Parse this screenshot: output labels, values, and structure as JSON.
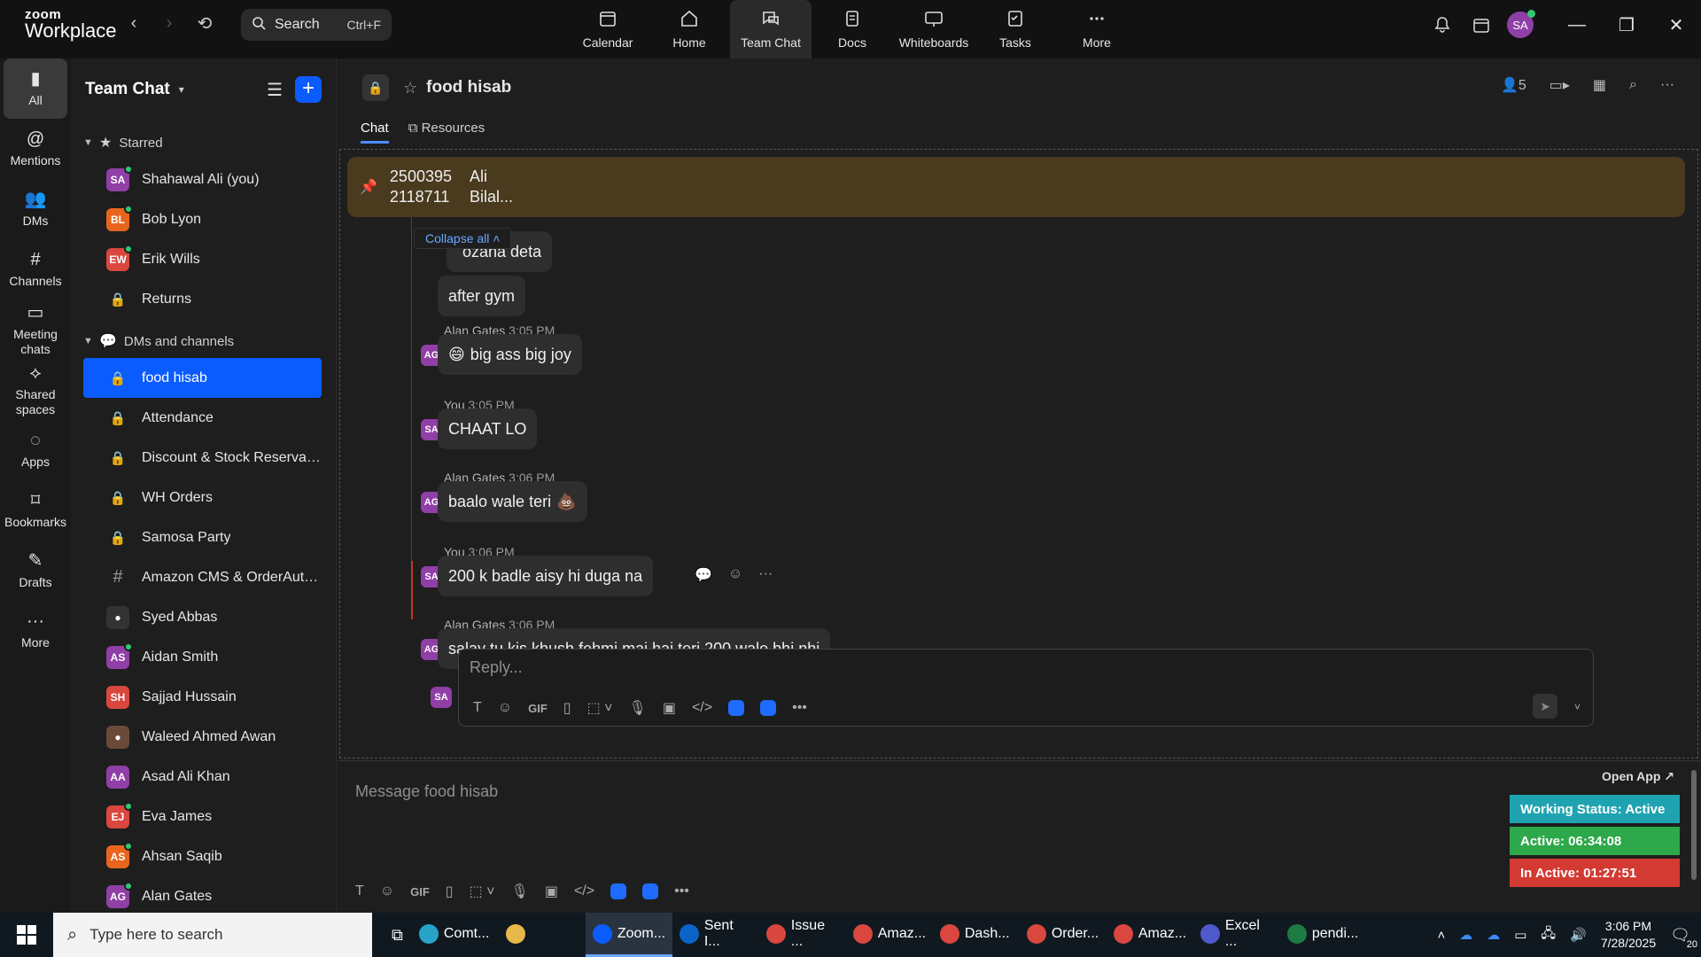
{
  "app": {
    "logo_line1": "zoom",
    "logo_line2": "Workplace"
  },
  "search": {
    "label": "Search",
    "shortcut": "Ctrl+F"
  },
  "topnav": [
    {
      "label": "Calendar",
      "icon": "calendar-icon"
    },
    {
      "label": "Home",
      "icon": "home-icon"
    },
    {
      "label": "Team Chat",
      "icon": "chat-icon",
      "active": true
    },
    {
      "label": "Docs",
      "icon": "docs-icon"
    },
    {
      "label": "Whiteboards",
      "icon": "whiteboard-icon"
    },
    {
      "label": "Tasks",
      "icon": "tasks-icon"
    },
    {
      "label": "More",
      "icon": "more-icon"
    }
  ],
  "user_avatar": "SA",
  "rail": [
    {
      "label": "All",
      "active": true
    },
    {
      "label": "Mentions"
    },
    {
      "label": "DMs"
    },
    {
      "label": "Channels"
    },
    {
      "label": "Meeting chats"
    },
    {
      "label": "Shared spaces"
    },
    {
      "label": "Apps"
    },
    {
      "label": "Bookmarks"
    },
    {
      "label": "Drafts"
    },
    {
      "label": "More"
    }
  ],
  "sidebar": {
    "title": "Team Chat",
    "starred_label": "Starred",
    "starred": [
      {
        "type": "avatar",
        "initials": "SA",
        "color": "#8f3fa5",
        "label": "Shahawal Ali (you)",
        "online": true
      },
      {
        "type": "avatar",
        "initials": "BL",
        "color": "#e8651e",
        "label": "Bob Lyon",
        "online": true
      },
      {
        "type": "avatar",
        "initials": "EW",
        "color": "#d9473f",
        "label": "Erik Wills",
        "online": true
      },
      {
        "type": "lock",
        "label": "Returns"
      }
    ],
    "dms_label": "DMs and channels",
    "dms": [
      {
        "type": "lock",
        "label": "food hisab",
        "active": true
      },
      {
        "type": "lock",
        "label": "Attendance"
      },
      {
        "type": "lock",
        "label": "Discount & Stock Reservatio..."
      },
      {
        "type": "lock",
        "label": "WH Orders"
      },
      {
        "type": "lock",
        "label": "Samosa Party"
      },
      {
        "type": "hash",
        "label": "Amazon CMS & OrderAuto..."
      },
      {
        "type": "photo",
        "color": "#333333",
        "label": "Syed Abbas"
      },
      {
        "type": "avatar",
        "initials": "AS",
        "color": "#8f3fa5",
        "label": "Aidan Smith",
        "online": true
      },
      {
        "type": "avatar",
        "initials": "SH",
        "color": "#d9473f",
        "label": "Sajjad Hussain"
      },
      {
        "type": "photo",
        "color": "#6b4a3a",
        "label": "Waleed Ahmed Awan"
      },
      {
        "type": "avatar",
        "initials": "AA",
        "color": "#8f3fa5",
        "label": "Asad Ali Khan"
      },
      {
        "type": "avatar",
        "initials": "EJ",
        "color": "#d9473f",
        "label": "Eva James",
        "online": true
      },
      {
        "type": "avatar",
        "initials": "AS",
        "color": "#e8651e",
        "label": "Ahsan Saqib",
        "online": true
      },
      {
        "type": "avatar",
        "initials": "AG",
        "color": "#8f3fa5",
        "label": "Alan Gates",
        "online": true
      }
    ]
  },
  "channel": {
    "name": "food hisab",
    "member_count": "5",
    "tabs": [
      "Chat",
      "Resources"
    ],
    "pinned": {
      "numbers_1": "2500395",
      "numbers_2": "2118711",
      "name_1": "Ali",
      "name_2": "Bilal..."
    },
    "collapse_label": "Collapse all",
    "partial_msg": "ozana deta",
    "messages": [
      {
        "text": "after gym"
      },
      {
        "sender": "Alan Gates",
        "time": "3:05 PM",
        "avatar": "AG",
        "emoji": "😄",
        "text": "big ass big joy"
      },
      {
        "sender": "You",
        "time": "3:05 PM",
        "avatar": "SA",
        "text": "CHAAT LO"
      },
      {
        "sender": "Alan Gates",
        "time": "3:06 PM",
        "avatar": "AG",
        "text": "baalo wale teri",
        "emoji_after": "💩"
      },
      {
        "sender": "You",
        "time": "3:06 PM",
        "avatar": "SA",
        "text": "200 k badle aisy hi duga na"
      },
      {
        "sender": "Alan Gates",
        "time": "3:06 PM",
        "avatar": "AG",
        "text": "salay tu kis khush fehmi mai hai teri 200 wale bhi nhi"
      }
    ],
    "reply_placeholder": "Reply...",
    "reply_avatar": "SA",
    "compose_placeholder": "Message food hisab",
    "toolbar_gif": "GIF"
  },
  "status_panel": {
    "open_app": "Open App ↗",
    "working": "Working Status: Active",
    "active": "Active: 06:34:08",
    "inactive": "In Active: 01:27:51"
  },
  "taskbar": {
    "search_placeholder": "Type here to search",
    "apps": [
      {
        "label": "Comt...",
        "color": "#27a3c9"
      },
      {
        "label": "",
        "color": "#e8b84a"
      },
      {
        "label": "Zoom...",
        "color": "#0b5cff",
        "active": true
      },
      {
        "label": "Sent I...",
        "color": "#0a64c8"
      },
      {
        "label": "Issue ...",
        "color": "#d9473f"
      },
      {
        "label": "Amaz...",
        "color": "#d9473f"
      },
      {
        "label": "Dash...",
        "color": "#d9473f"
      },
      {
        "label": "Order...",
        "color": "#d9473f"
      },
      {
        "label": "Amaz...",
        "color": "#d9473f"
      },
      {
        "label": "Excel ...",
        "color": "#5059c9"
      },
      {
        "label": "pendi...",
        "color": "#1d7a43"
      }
    ],
    "time": "3:06 PM",
    "date": "7/28/2025",
    "notifications": "20"
  }
}
